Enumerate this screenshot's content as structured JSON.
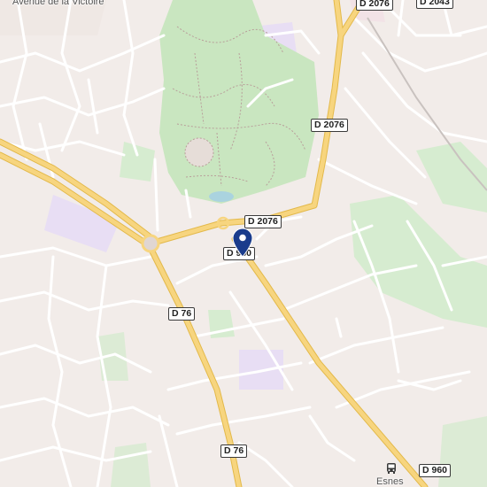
{
  "map": {
    "place_labels": {
      "avenue": "Avenue de la Victoire",
      "esnes": "Esnes"
    },
    "road_labels": {
      "d2076_top": "D 2076",
      "d2043": "D 2043",
      "d2076_east": "D 2076",
      "d2076_center": "D 2076",
      "d960_center": "D 960",
      "d76_mid": "D 76",
      "d76_south": "D 76",
      "d960_south": "D 960"
    },
    "icons": {
      "marker": "location-pin-icon",
      "bus": "bus-stop-icon"
    },
    "colors": {
      "background": "#f2ece9",
      "major_road": "#f7d57f",
      "park": "#c9e6c0",
      "marker": "#1a3c8c"
    }
  }
}
